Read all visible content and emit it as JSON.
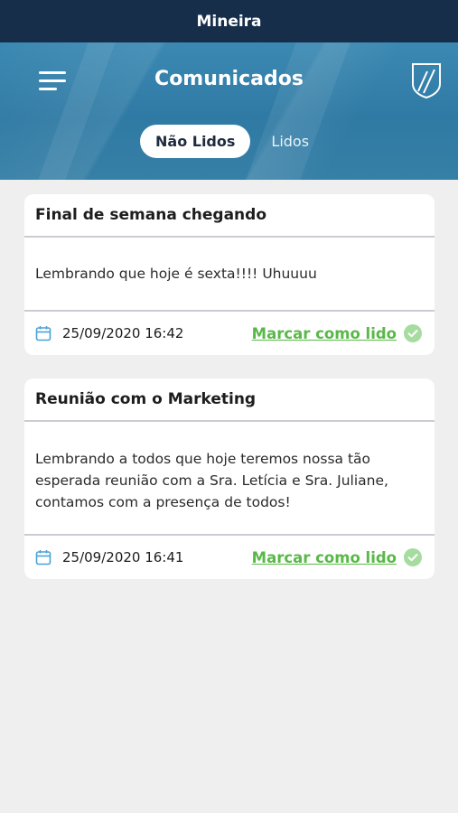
{
  "status_bar": {
    "title": "Mineira"
  },
  "header": {
    "title": "Comunicados",
    "menu_icon": "hamburger-menu-icon",
    "logo_icon": "shield-logo-icon"
  },
  "tabs": [
    {
      "label": "Não Lidos",
      "active": true
    },
    {
      "label": "Lidos",
      "active": false
    }
  ],
  "messages": [
    {
      "title": "Final de semana chegando",
      "body_lines": [
        "Lembrando que hoje é sexta!!!! Uhuuuu"
      ],
      "date": "25/09/2020 16:42",
      "action_label": "Marcar como lido"
    },
    {
      "title": "Reunião com o Marketing",
      "body_lines": [
        "Lembrando a todos que hoje teremos nossa tão",
        "esperada reunião com a Sra. Letícia e Sra. Juliane,",
        "contamos com a presença de todos!"
      ],
      "date": "25/09/2020 16:41",
      "action_label": "Marcar como lido"
    }
  ],
  "colors": {
    "status_bar": "#172e4b",
    "header": "#2f7aa4",
    "accent_green": "#58b947",
    "check_green": "#a6dca0",
    "calendar_blue": "#4aa3d6",
    "background": "#efefef"
  }
}
